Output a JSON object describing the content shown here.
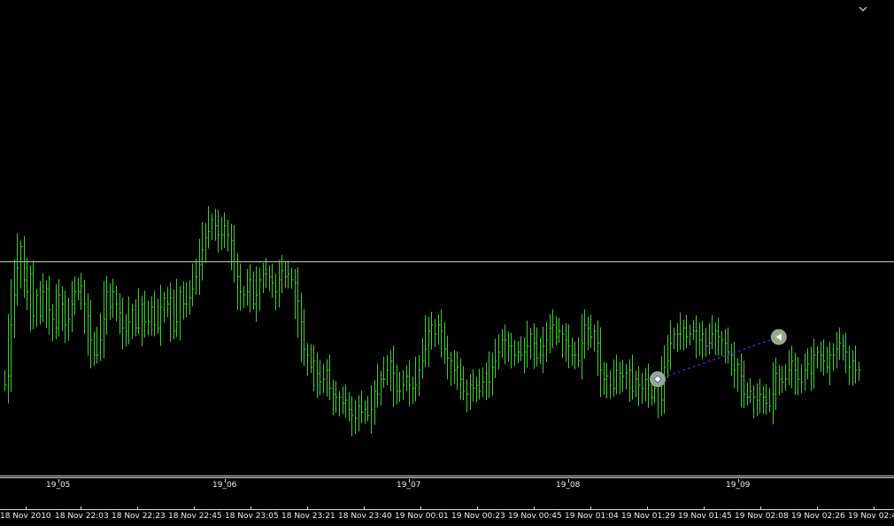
{
  "chart_data": {
    "type": "bar",
    "title": "",
    "xlabel": "",
    "ylabel": "",
    "style": "tick-bars",
    "colors": {
      "background": "#000000",
      "bars": "#3ecf2e",
      "level_line": "#c8d8c0",
      "trade_line": "#2a3cff",
      "trade_marker": "#9aa889",
      "axis_text": "#f0f0f0"
    },
    "ylim": [
      0,
      100
    ],
    "grid": false,
    "level": 66,
    "sessions": [
      "19_05",
      "19_06",
      "19_07",
      "19_08",
      "19_09"
    ],
    "time_labels": [
      "18 Nov 2010",
      "18 Nov 22:03",
      "18 Nov 22:23",
      "18 Nov 22:45",
      "18 Nov 23:05",
      "18 Nov 23:21",
      "18 Nov 23:40",
      "19 Nov 00:01",
      "19 Nov 00:23",
      "19 Nov 00:45",
      "19 Nov 01:04",
      "19 Nov 01:29",
      "19 Nov 01:45",
      "19 Nov 02:08",
      "19 Nov 02:26",
      "19 Nov 02:4"
    ],
    "series": [
      {
        "values": [
          25,
          28,
          45,
          55,
          64,
          71,
          60,
          56,
          62,
          48,
          55,
          48,
          56,
          57,
          50,
          47,
          44,
          55,
          52,
          45,
          47,
          52,
          56,
          56,
          58,
          52,
          48,
          40,
          35,
          35,
          40,
          47,
          56,
          51,
          56,
          52,
          49,
          44,
          43,
          46,
          50,
          44,
          44,
          52,
          46,
          46,
          51,
          45,
          44,
          51,
          54,
          52,
          54,
          43,
          46,
          56,
          52,
          52,
          54,
          57,
          61,
          65,
          70,
          74,
          76,
          80,
          78,
          75,
          75,
          78,
          75,
          73,
          66,
          61,
          56,
          55,
          56,
          60,
          52,
          55,
          60,
          62,
          62,
          61,
          59,
          56,
          60,
          63,
          61,
          62,
          60,
          59,
          53,
          46,
          37,
          35,
          31,
          33,
          29,
          26,
          27,
          30,
          24,
          22,
          21,
          21,
          19,
          20,
          17,
          15,
          14,
          18,
          16,
          17,
          15,
          17,
          23,
          22,
          27,
          27,
          30,
          33,
          29,
          23,
          23,
          25,
          28,
          25,
          24,
          25,
          30,
          33,
          37,
          43,
          45,
          42,
          45,
          43,
          37,
          34,
          33,
          30,
          31,
          27,
          23,
          22,
          25,
          24,
          25,
          23,
          26,
          29,
          26,
          31,
          33,
          36,
          40,
          40,
          38,
          38,
          35,
          36,
          35,
          36,
          38,
          42,
          39,
          34,
          35,
          38,
          40,
          44,
          45,
          41,
          43,
          42,
          40,
          38,
          35,
          35,
          33,
          39,
          45,
          44,
          41,
          43,
          39,
          30,
          27,
          28,
          25,
          24,
          30,
          29,
          28,
          29,
          30,
          23,
          27,
          25,
          24,
          27,
          25,
          21,
          24,
          25,
          20,
          31,
          33,
          39,
          42,
          42,
          42,
          44,
          41,
          42,
          43,
          43,
          40,
          42,
          38,
          39,
          42,
          43,
          41,
          40,
          39,
          36,
          35,
          30,
          32,
          28,
          22,
          21,
          23,
          21,
          20,
          22,
          21,
          19,
          18,
          22,
          29,
          27,
          26,
          27,
          30,
          33,
          30,
          27,
          26,
          30,
          32,
          29,
          35,
          36,
          35,
          33,
          31,
          35,
          35,
          37,
          39,
          38,
          36,
          31,
          33,
          30,
          30
        ]
      }
    ],
    "trades": [
      {
        "from_index": 205,
        "from_value": 27,
        "to_index": 243,
        "to_value": 41
      }
    ]
  },
  "corner_icon": "chevron-down-icon"
}
